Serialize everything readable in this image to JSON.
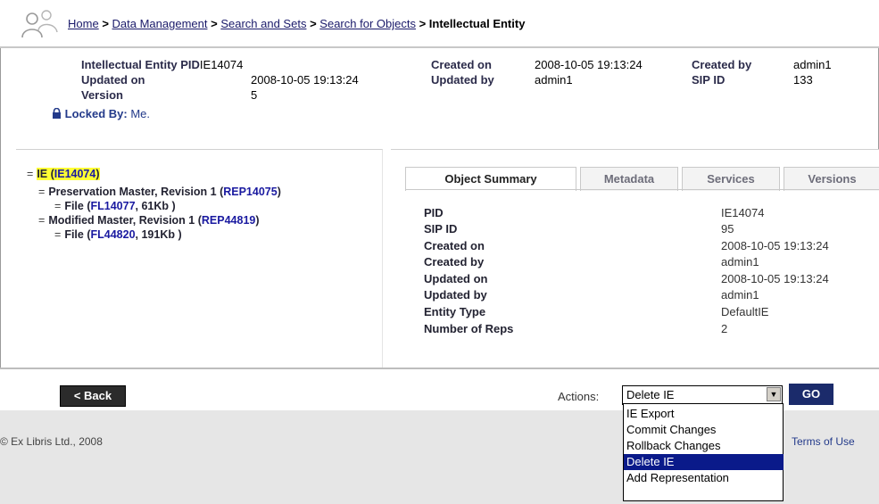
{
  "breadcrumb": {
    "home": "Home",
    "data_management": "Data Management",
    "search_and_sets": "Search and Sets",
    "search_for_objects": "Search for Objects",
    "current": "Intellectual Entity",
    "sep": ">"
  },
  "meta": {
    "ie_pid_label": "Intellectual Entity PID",
    "ie_pid_value": "IE14074",
    "updated_on_label": "Updated on",
    "updated_on_value": "2008-10-05 19:13:24",
    "version_label": "Version",
    "version_value": "5",
    "created_on_label": "Created on",
    "created_on_value": "2008-10-05 19:13:24",
    "updated_by_label": "Updated by",
    "updated_by_value": "admin1",
    "created_by_label": "Created by",
    "created_by_value": "admin1",
    "sip_id_label": "SIP ID",
    "sip_id_value": "133",
    "locked_label": "Locked By:",
    "locked_value": "Me."
  },
  "tree": {
    "ie_label": "IE (",
    "ie_id": "IE14074",
    "ie_close": ")",
    "rep1_label": "Preservation Master, Revision 1 (",
    "rep1_id": "REP14075",
    "rep1_close": ")",
    "file1_label": "File (",
    "file1_id": "FL14077",
    "file1_size": ", 61Kb )",
    "rep2_label": "Modified Master, Revision 1 (",
    "rep2_id": "REP44819",
    "rep2_close": ")",
    "file2_label": "File (",
    "file2_id": "FL44820",
    "file2_size": ", 191Kb )",
    "toggle": "="
  },
  "tabs": [
    {
      "label": "Object Summary",
      "active": true
    },
    {
      "label": "Metadata",
      "active": false
    },
    {
      "label": "Services",
      "active": false
    },
    {
      "label": "Versions",
      "active": false
    }
  ],
  "summary": [
    {
      "key": "PID",
      "value": "IE14074"
    },
    {
      "key": "SIP ID",
      "value": "95"
    },
    {
      "key": "Created on",
      "value": "2008-10-05 19:13:24"
    },
    {
      "key": "Created by",
      "value": "admin1"
    },
    {
      "key": "Updated on",
      "value": "2008-10-05 19:13:24"
    },
    {
      "key": "Updated by",
      "value": "admin1"
    },
    {
      "key": "Entity Type",
      "value": "DefaultIE"
    },
    {
      "key": "Number of Reps",
      "value": "2"
    }
  ],
  "bottom": {
    "back_label": "< Back",
    "actions_label": "Actions:",
    "selected_action": "Delete IE",
    "go_label": "GO",
    "options": [
      "IE Export",
      "Commit Changes",
      "Rollback Changes",
      "Delete IE",
      "Add Representation"
    ],
    "highlighted_option": "Delete IE"
  },
  "footer": {
    "copyright": "© Ex Libris Ltd., 2008",
    "terms": "Terms of Use"
  },
  "colors": {
    "highlight": "#ffff33",
    "go_button": "#1b2b6b",
    "selected_option": "#0a1a8a",
    "footer_bg": "#e6e6e6"
  },
  "icons": {
    "logo": "people-logo-icon",
    "lock": "lock-icon",
    "dropdown": "chevron-down-icon"
  }
}
